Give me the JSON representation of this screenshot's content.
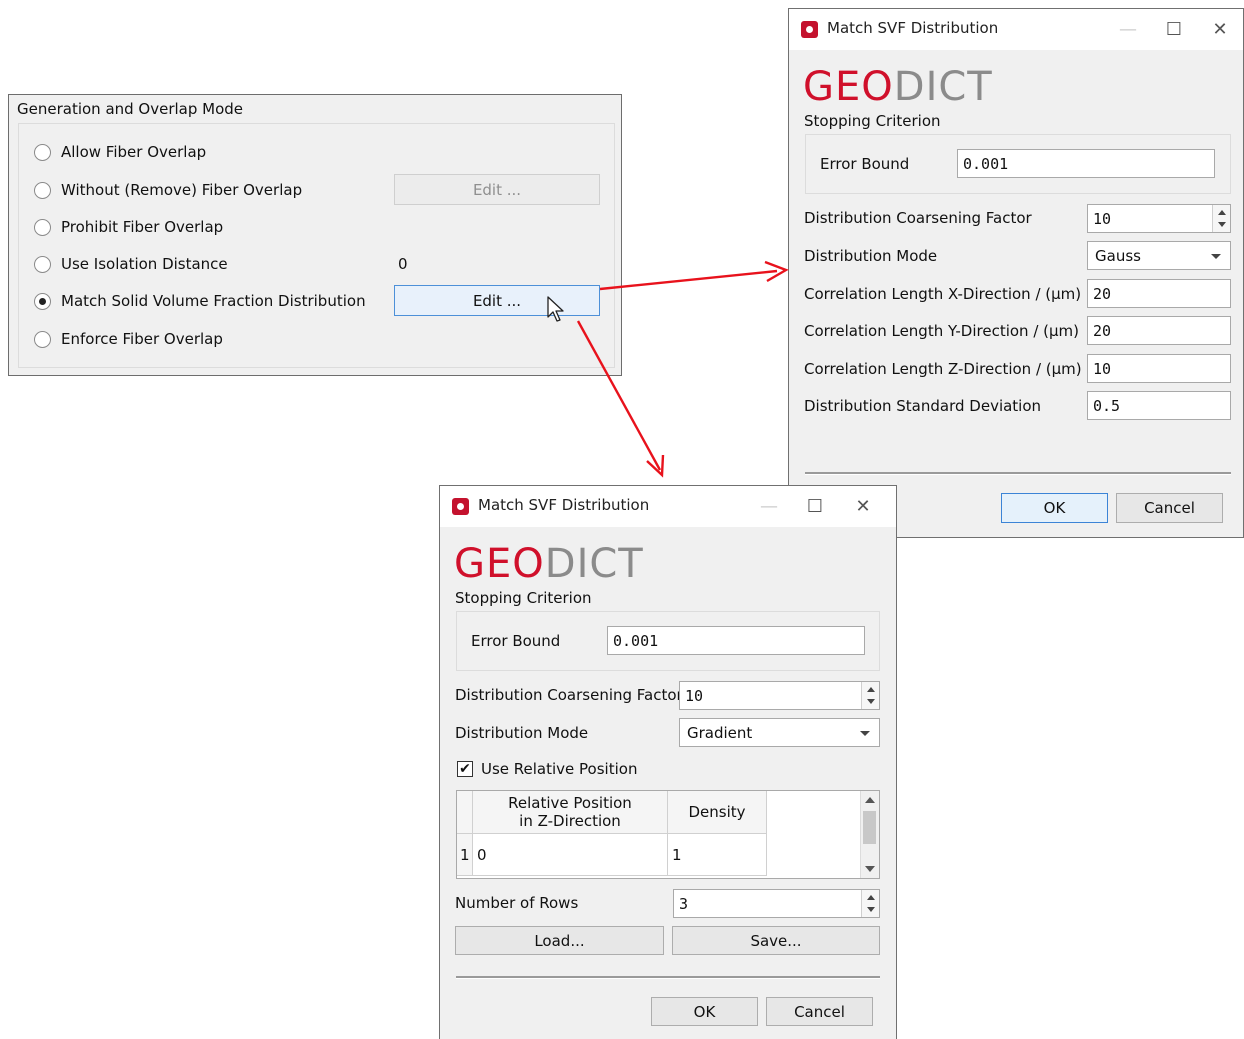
{
  "generation": {
    "title": "Generation and Overlap Mode",
    "options": [
      {
        "label": "Allow Fiber Overlap",
        "selected": false
      },
      {
        "label": "Without (Remove) Fiber Overlap",
        "selected": false
      },
      {
        "label": "Prohibit Fiber Overlap",
        "selected": false
      },
      {
        "label": "Use Isolation Distance",
        "selected": false
      },
      {
        "label": "Match Solid Volume Fraction Distribution",
        "selected": true
      },
      {
        "label": "Enforce Fiber Overlap",
        "selected": false
      }
    ],
    "edit_button_disabled": "Edit ...",
    "isolation_value": "0",
    "edit_button_active": "Edit ..."
  },
  "dialog1": {
    "title": "Match SVF Distribution",
    "logo_geo": "GEO",
    "logo_dict": "DICT",
    "stopping_criterion": "Stopping Criterion",
    "error_bound_label": "Error Bound",
    "error_bound_value": "0.001",
    "coarsening_label": "Distribution Coarsening Factor",
    "coarsening_value": "10",
    "mode_label": "Distribution Mode",
    "mode_value": "Gauss",
    "corr_x_label": "Correlation Length X-Direction / (µm)",
    "corr_x_value": "20",
    "corr_y_label": "Correlation Length Y-Direction / (µm)",
    "corr_y_value": "20",
    "corr_z_label": "Correlation Length Z-Direction / (µm)",
    "corr_z_value": "10",
    "std_label": "Distribution Standard Deviation",
    "std_value": "0.5",
    "ok": "OK",
    "cancel": "Cancel"
  },
  "dialog2": {
    "title": "Match SVF Distribution",
    "logo_geo": "GEO",
    "logo_dict": "DICT",
    "stopping_criterion": "Stopping Criterion",
    "error_bound_label": "Error Bound",
    "error_bound_value": "0.001",
    "coarsening_label": "Distribution Coarsening Factor",
    "coarsening_value": "10",
    "mode_label": "Distribution Mode",
    "mode_value": "Gradient",
    "use_relative_label": "Use Relative Position",
    "use_relative_checked": true,
    "check_glyph": "✔",
    "table": {
      "col1_line1": "Relative Position",
      "col1_line2": "in Z-Direction",
      "col2": "Density",
      "rows": [
        {
          "index": "1",
          "position": "0",
          "density": "1"
        }
      ]
    },
    "rows_label": "Number of Rows",
    "rows_value": "3",
    "load": "Load...",
    "save": "Save...",
    "ok": "OK",
    "cancel": "Cancel"
  },
  "window_controls": {
    "minimize": "—",
    "maximize": "☐",
    "close": "✕"
  },
  "colors": {
    "arrow": "#e8121c",
    "logo_red": "#d0102b",
    "logo_gray": "#8b8b8b"
  }
}
